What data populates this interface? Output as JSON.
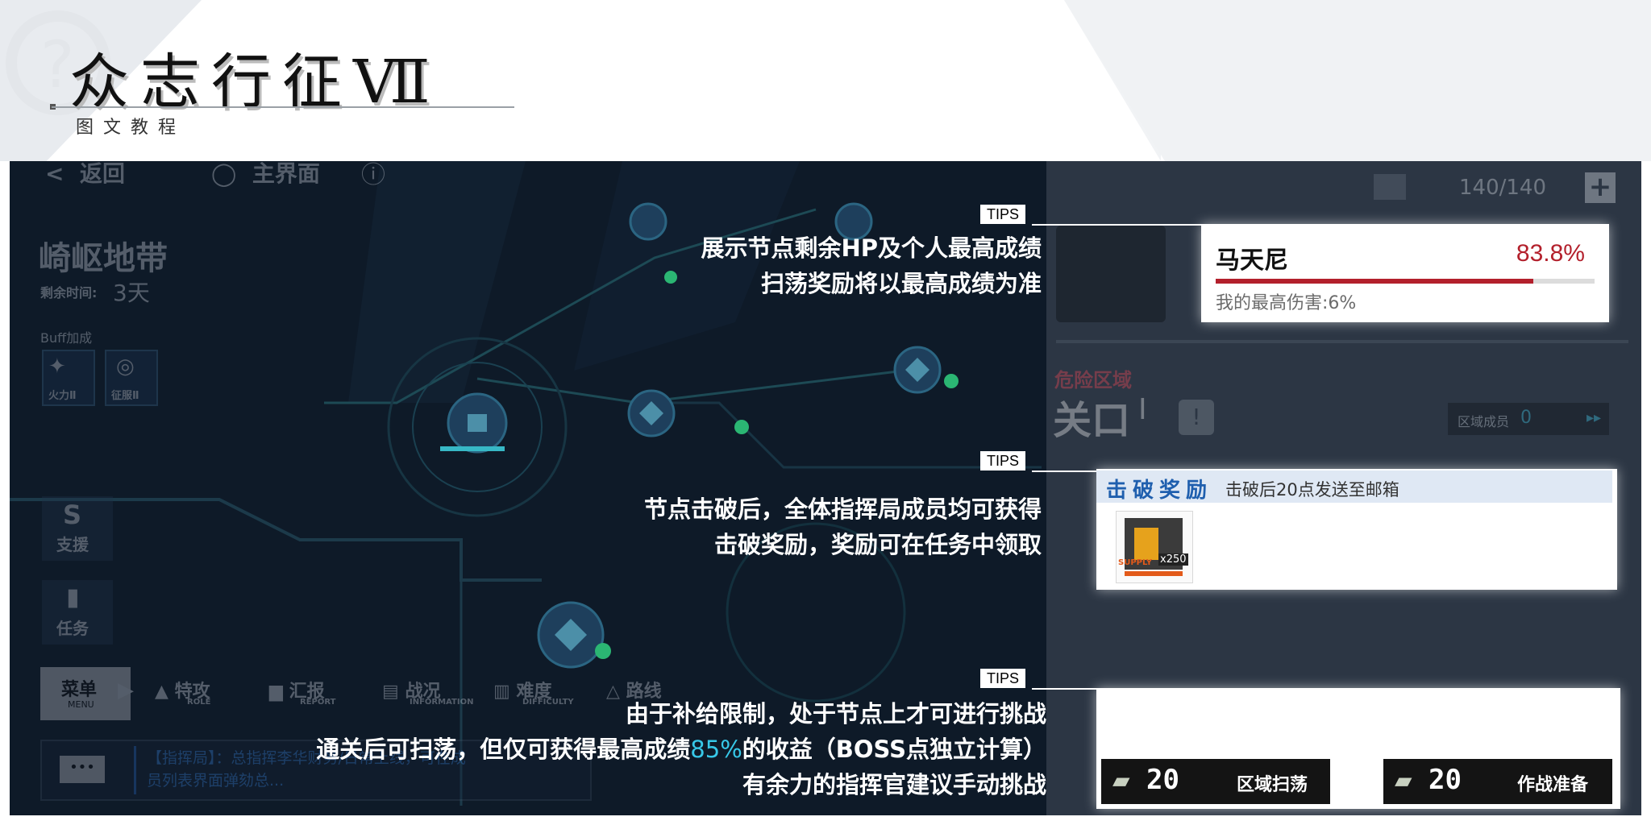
{
  "header": {
    "title": "众志行征Ⅶ",
    "subtitle": "图文教程"
  },
  "game": {
    "top_nav": {
      "back": "返回",
      "home": "主界面"
    },
    "area_name": "崎岖地带",
    "remaining_time_label": "剩余时间:",
    "remaining_time_value": "3天",
    "buff_label": "Buff加成",
    "buffs": [
      "火力Ⅱ",
      "征服Ⅱ"
    ],
    "side_buttons": [
      "支援",
      "任务"
    ],
    "menu_label": "菜单",
    "menu_sub": "MENU",
    "bottom_nav": [
      {
        "cn": "特攻",
        "en": "ROLE"
      },
      {
        "cn": "汇报",
        "en": "REPORT"
      },
      {
        "cn": "战况",
        "en": "INFORMATION"
      },
      {
        "cn": "难度",
        "en": "DIFFICULTY"
      },
      {
        "cn": "路线",
        "en": ""
      }
    ],
    "chat_text_line1": "【指挥局】：总指挥李华财务/日常上线，可在成",
    "chat_text_line2": "员列表界面弹劾总...",
    "stamina": "140/140",
    "boss": {
      "name": "马天尼",
      "hp_percent_label": "83.8%",
      "hp_fraction": 0.838,
      "my_best_label": "我的最高伤害:6%"
    },
    "danger_label": "危险区域",
    "node_name": "关口",
    "node_level": "Ⅰ",
    "members_label": "区域成员",
    "members_count": "0",
    "reward": {
      "title": "击破奖励",
      "desc": "击破后20点发送至邮箱",
      "item_qty": "x250",
      "item_tag": "SUPPLY"
    },
    "actions": [
      {
        "cost": "20",
        "label": "区域扫荡"
      },
      {
        "cost": "20",
        "label": "作战准备"
      }
    ]
  },
  "tips": [
    {
      "tag": "TIPS",
      "lines": [
        "展示节点剩余HP及个人最高成绩",
        "扫荡奖励将以最高成绩为准"
      ]
    },
    {
      "tag": "TIPS",
      "lines": [
        "节点击破后，全体指挥局成员均可获得",
        "击破奖励，奖励可在任务中领取"
      ]
    },
    {
      "tag": "TIPS",
      "line1": "由于补给限制，处于节点上才可进行挑战",
      "line2_pre": "通关后可扫荡，但仅可获得最高成绩",
      "line2_highlight": "85%",
      "line2_post": "的收益（BOSS点独立计算）",
      "line3": "有余力的指挥官建议手动挑战"
    }
  ],
  "colors": {
    "accent_red": "#b3202c",
    "highlight_cyan": "#37c8e8",
    "reward_blue": "#1f5fae"
  }
}
